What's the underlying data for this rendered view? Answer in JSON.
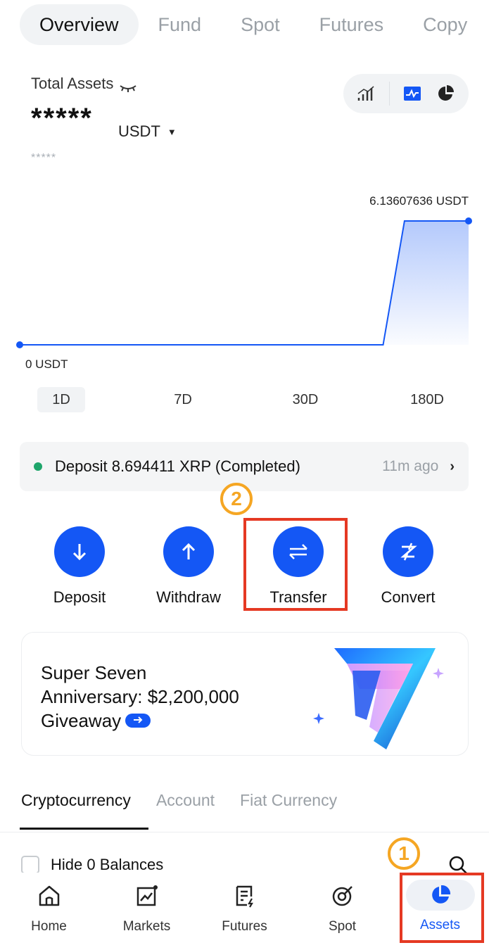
{
  "top_tabs": [
    "Overview",
    "Fund",
    "Spot",
    "Futures",
    "Copy"
  ],
  "total_assets": {
    "label": "Total Assets",
    "masked_value": "*****",
    "currency": "USDT",
    "masked_sub": "*****"
  },
  "chart_data": {
    "type": "area",
    "x": [
      0,
      1,
      2,
      3,
      4,
      5,
      6,
      7,
      8,
      9,
      10,
      11,
      12,
      13,
      14,
      15,
      16,
      17,
      18,
      19,
      20,
      21
    ],
    "values": [
      0,
      0,
      0,
      0,
      0,
      0,
      0,
      0,
      0,
      0,
      0,
      0,
      0,
      0,
      0,
      0,
      0,
      0,
      6.13607636,
      6.13607636,
      6.13607636,
      6.13607636
    ],
    "max_label": "6.13607636 USDT",
    "min_label": "0 USDT",
    "ylim": [
      0,
      6.13607636
    ],
    "color": "#1457f5"
  },
  "periods": [
    "1D",
    "7D",
    "30D",
    "180D"
  ],
  "notice": {
    "text": "Deposit 8.694411 XRP (Completed)",
    "time": "11m ago"
  },
  "step_markers": {
    "first": "1",
    "second": "2"
  },
  "actions": [
    {
      "label": "Deposit",
      "icon": "arrow-down-icon"
    },
    {
      "label": "Withdraw",
      "icon": "arrow-up-icon"
    },
    {
      "label": "Transfer",
      "icon": "transfer-arrows-icon"
    },
    {
      "label": "Convert",
      "icon": "convert-icon"
    }
  ],
  "banner": {
    "line1": "Super Seven",
    "line2": "Anniversary: $2,200,000",
    "line3": "Giveaway"
  },
  "sub_tabs": [
    "Cryptocurrency",
    "Account",
    "Fiat Currency"
  ],
  "hide_balances_label": "Hide 0 Balances",
  "bottom_nav": [
    {
      "label": "Home",
      "icon": "home-icon"
    },
    {
      "label": "Markets",
      "icon": "markets-icon"
    },
    {
      "label": "Futures",
      "icon": "futures-icon"
    },
    {
      "label": "Spot",
      "icon": "spot-icon"
    },
    {
      "label": "Assets",
      "icon": "pie-chart-icon"
    }
  ],
  "colors": {
    "accent": "#1457f5",
    "highlight": "#e53923",
    "marker": "#f5a623",
    "success": "#1ea56b"
  }
}
